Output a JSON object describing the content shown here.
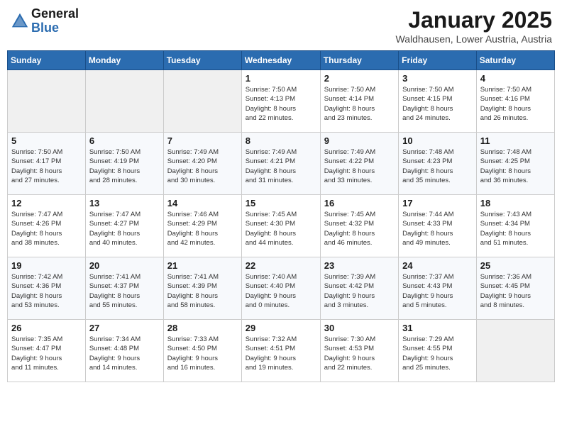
{
  "header": {
    "logo_general": "General",
    "logo_blue": "Blue",
    "month_title": "January 2025",
    "location": "Waldhausen, Lower Austria, Austria"
  },
  "weekdays": [
    "Sunday",
    "Monday",
    "Tuesday",
    "Wednesday",
    "Thursday",
    "Friday",
    "Saturday"
  ],
  "weeks": [
    [
      {
        "day": "",
        "info": ""
      },
      {
        "day": "",
        "info": ""
      },
      {
        "day": "",
        "info": ""
      },
      {
        "day": "1",
        "info": "Sunrise: 7:50 AM\nSunset: 4:13 PM\nDaylight: 8 hours\nand 22 minutes."
      },
      {
        "day": "2",
        "info": "Sunrise: 7:50 AM\nSunset: 4:14 PM\nDaylight: 8 hours\nand 23 minutes."
      },
      {
        "day": "3",
        "info": "Sunrise: 7:50 AM\nSunset: 4:15 PM\nDaylight: 8 hours\nand 24 minutes."
      },
      {
        "day": "4",
        "info": "Sunrise: 7:50 AM\nSunset: 4:16 PM\nDaylight: 8 hours\nand 26 minutes."
      }
    ],
    [
      {
        "day": "5",
        "info": "Sunrise: 7:50 AM\nSunset: 4:17 PM\nDaylight: 8 hours\nand 27 minutes."
      },
      {
        "day": "6",
        "info": "Sunrise: 7:50 AM\nSunset: 4:19 PM\nDaylight: 8 hours\nand 28 minutes."
      },
      {
        "day": "7",
        "info": "Sunrise: 7:49 AM\nSunset: 4:20 PM\nDaylight: 8 hours\nand 30 minutes."
      },
      {
        "day": "8",
        "info": "Sunrise: 7:49 AM\nSunset: 4:21 PM\nDaylight: 8 hours\nand 31 minutes."
      },
      {
        "day": "9",
        "info": "Sunrise: 7:49 AM\nSunset: 4:22 PM\nDaylight: 8 hours\nand 33 minutes."
      },
      {
        "day": "10",
        "info": "Sunrise: 7:48 AM\nSunset: 4:23 PM\nDaylight: 8 hours\nand 35 minutes."
      },
      {
        "day": "11",
        "info": "Sunrise: 7:48 AM\nSunset: 4:25 PM\nDaylight: 8 hours\nand 36 minutes."
      }
    ],
    [
      {
        "day": "12",
        "info": "Sunrise: 7:47 AM\nSunset: 4:26 PM\nDaylight: 8 hours\nand 38 minutes."
      },
      {
        "day": "13",
        "info": "Sunrise: 7:47 AM\nSunset: 4:27 PM\nDaylight: 8 hours\nand 40 minutes."
      },
      {
        "day": "14",
        "info": "Sunrise: 7:46 AM\nSunset: 4:29 PM\nDaylight: 8 hours\nand 42 minutes."
      },
      {
        "day": "15",
        "info": "Sunrise: 7:45 AM\nSunset: 4:30 PM\nDaylight: 8 hours\nand 44 minutes."
      },
      {
        "day": "16",
        "info": "Sunrise: 7:45 AM\nSunset: 4:32 PM\nDaylight: 8 hours\nand 46 minutes."
      },
      {
        "day": "17",
        "info": "Sunrise: 7:44 AM\nSunset: 4:33 PM\nDaylight: 8 hours\nand 49 minutes."
      },
      {
        "day": "18",
        "info": "Sunrise: 7:43 AM\nSunset: 4:34 PM\nDaylight: 8 hours\nand 51 minutes."
      }
    ],
    [
      {
        "day": "19",
        "info": "Sunrise: 7:42 AM\nSunset: 4:36 PM\nDaylight: 8 hours\nand 53 minutes."
      },
      {
        "day": "20",
        "info": "Sunrise: 7:41 AM\nSunset: 4:37 PM\nDaylight: 8 hours\nand 55 minutes."
      },
      {
        "day": "21",
        "info": "Sunrise: 7:41 AM\nSunset: 4:39 PM\nDaylight: 8 hours\nand 58 minutes."
      },
      {
        "day": "22",
        "info": "Sunrise: 7:40 AM\nSunset: 4:40 PM\nDaylight: 9 hours\nand 0 minutes."
      },
      {
        "day": "23",
        "info": "Sunrise: 7:39 AM\nSunset: 4:42 PM\nDaylight: 9 hours\nand 3 minutes."
      },
      {
        "day": "24",
        "info": "Sunrise: 7:37 AM\nSunset: 4:43 PM\nDaylight: 9 hours\nand 5 minutes."
      },
      {
        "day": "25",
        "info": "Sunrise: 7:36 AM\nSunset: 4:45 PM\nDaylight: 9 hours\nand 8 minutes."
      }
    ],
    [
      {
        "day": "26",
        "info": "Sunrise: 7:35 AM\nSunset: 4:47 PM\nDaylight: 9 hours\nand 11 minutes."
      },
      {
        "day": "27",
        "info": "Sunrise: 7:34 AM\nSunset: 4:48 PM\nDaylight: 9 hours\nand 14 minutes."
      },
      {
        "day": "28",
        "info": "Sunrise: 7:33 AM\nSunset: 4:50 PM\nDaylight: 9 hours\nand 16 minutes."
      },
      {
        "day": "29",
        "info": "Sunrise: 7:32 AM\nSunset: 4:51 PM\nDaylight: 9 hours\nand 19 minutes."
      },
      {
        "day": "30",
        "info": "Sunrise: 7:30 AM\nSunset: 4:53 PM\nDaylight: 9 hours\nand 22 minutes."
      },
      {
        "day": "31",
        "info": "Sunrise: 7:29 AM\nSunset: 4:55 PM\nDaylight: 9 hours\nand 25 minutes."
      },
      {
        "day": "",
        "info": ""
      }
    ]
  ]
}
